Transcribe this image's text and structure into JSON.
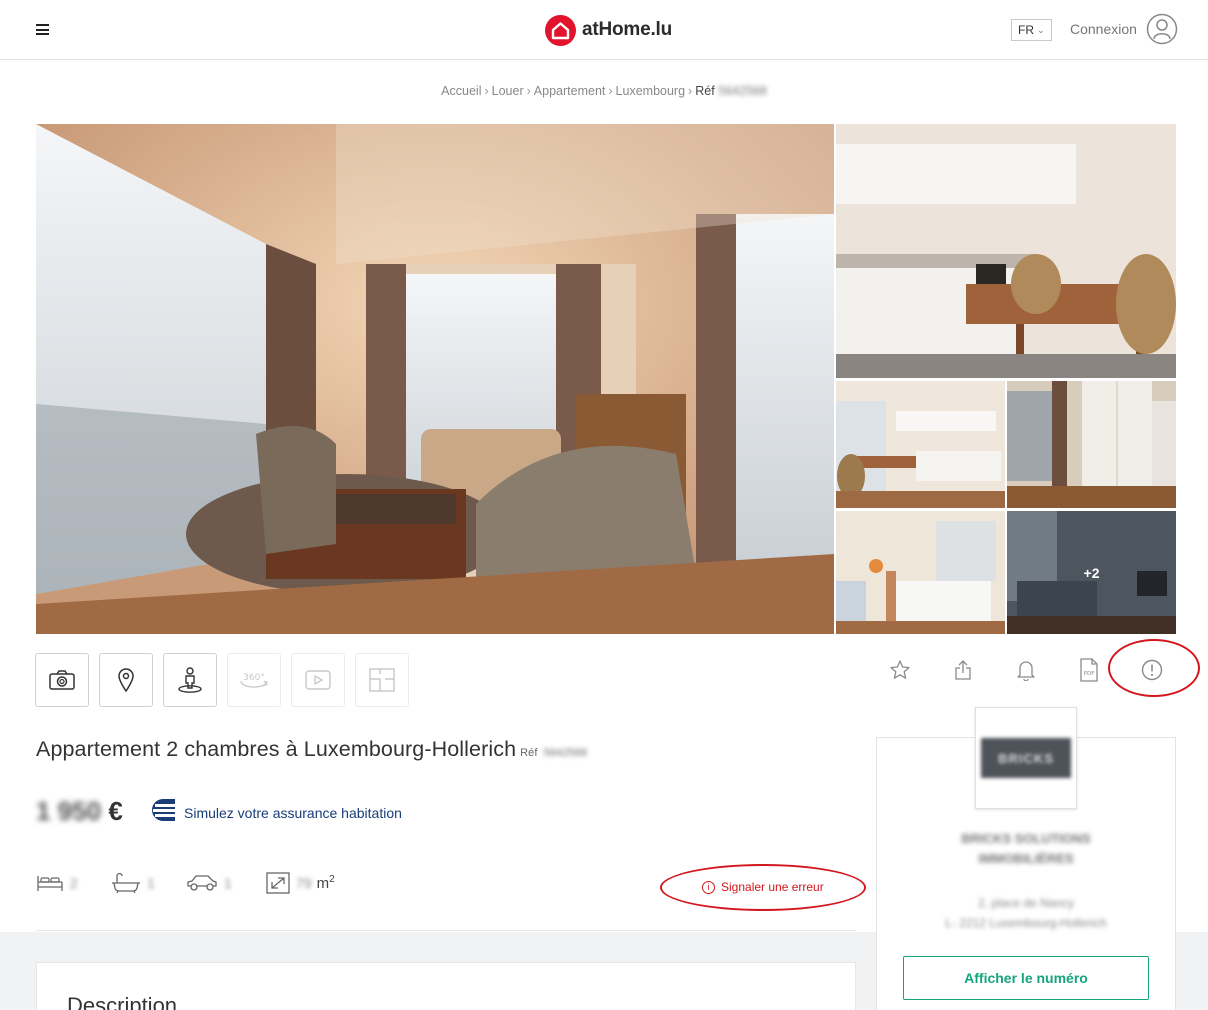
{
  "header": {
    "logo_text": "atHome.lu",
    "language": "FR",
    "login_label": "Connexion"
  },
  "breadcrumb": {
    "items": [
      "Accueil",
      "Louer",
      "Appartement",
      "Luxembourg"
    ],
    "ref_label": "Réf",
    "ref_value": "5642568"
  },
  "gallery": {
    "more_photos": "+2"
  },
  "listing": {
    "title": "Appartement 2 chambres à Luxembourg-Hollerich",
    "ref_label": "Réf",
    "ref_value": "5642568",
    "price_amount": "1 950",
    "price_currency": "€",
    "insurance_link": "Simulez votre assurance habitation",
    "bedrooms": "2",
    "bathrooms": "1",
    "parking": "1",
    "surface": "79",
    "surface_unit": "m",
    "surface_exp": "2",
    "report_error": "Signaler une erreur",
    "description_title": "Description"
  },
  "agent": {
    "logo_text": "BRICKS",
    "name_line1": "BRICKS SOLUTIONS",
    "name_line2": "IMMOBILIÈRES",
    "address_line1": "2, place de Nancy",
    "address_line2": "L- 2212 Luxembourg-Hollerich",
    "phone_button": "Afficher le numéro"
  },
  "colors": {
    "brand_red": "#e2142d",
    "annotation_red": "#d3171d",
    "accent_green": "#16a47c",
    "insurance_blue": "#1a3d78"
  }
}
